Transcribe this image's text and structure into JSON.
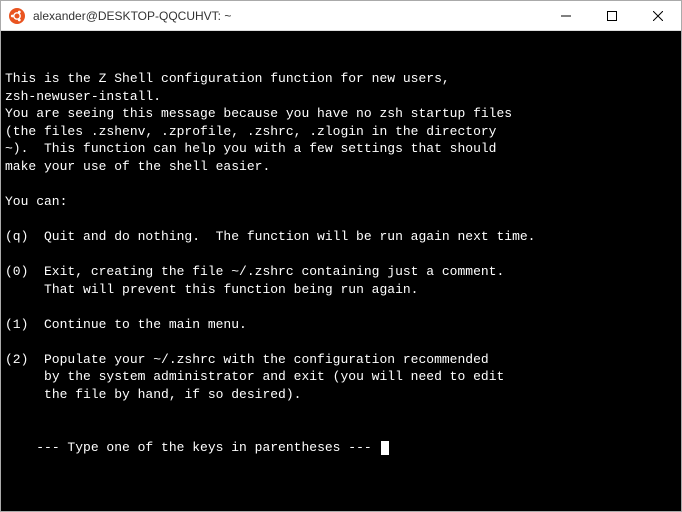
{
  "titlebar": {
    "title": "alexander@DESKTOP-QQCUHVT: ~"
  },
  "terminal": {
    "lines": [
      "This is the Z Shell configuration function for new users,",
      "zsh-newuser-install.",
      "You are seeing this message because you have no zsh startup files",
      "(the files .zshenv, .zprofile, .zshrc, .zlogin in the directory",
      "~).  This function can help you with a few settings that should",
      "make your use of the shell easier.",
      "",
      "You can:",
      "",
      "(q)  Quit and do nothing.  The function will be run again next time.",
      "",
      "(0)  Exit, creating the file ~/.zshrc containing just a comment.",
      "     That will prevent this function being run again.",
      "",
      "(1)  Continue to the main menu.",
      "",
      "(2)  Populate your ~/.zshrc with the configuration recommended",
      "     by the system administrator and exit (you will need to edit",
      "     the file by hand, if so desired).",
      ""
    ],
    "prompt": "--- Type one of the keys in parentheses --- "
  }
}
